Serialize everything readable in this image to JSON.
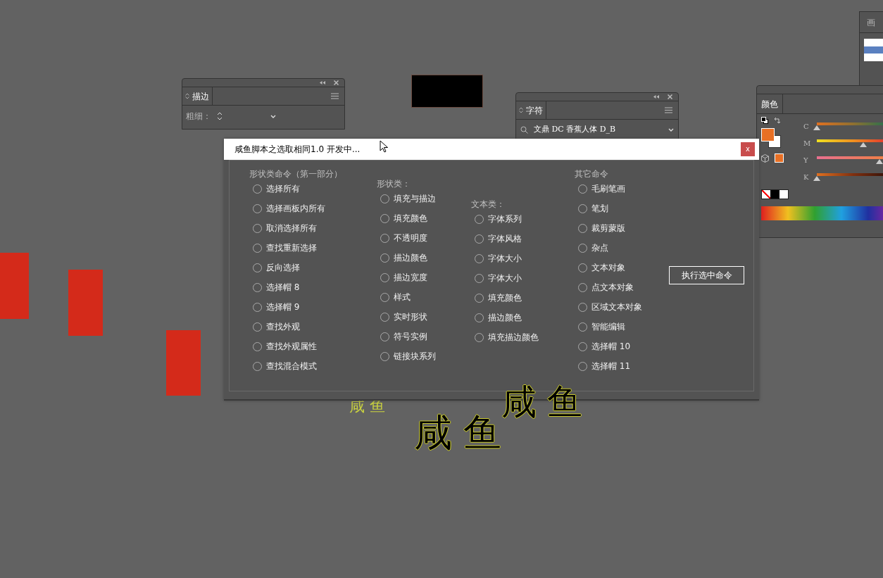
{
  "brush_panel": {
    "tab": "画"
  },
  "stroke_panel": {
    "tab": "描边",
    "weight_label": "粗细："
  },
  "character_panel": {
    "tab": "字符",
    "font": "文鼎 DC 香蕉人体 D_B"
  },
  "color_panel": {
    "tab": "颜色",
    "sliders": [
      {
        "label": "C",
        "level": 0
      },
      {
        "label": "M",
        "level": 0.64
      },
      {
        "label": "Y",
        "level": 0.86
      },
      {
        "label": "K",
        "level": 0
      }
    ]
  },
  "canvas_texts": [
    {
      "text": "咸鱼",
      "kind": "fill"
    },
    {
      "text": "咸鱼",
      "kind": "outline"
    },
    {
      "text": "咸鱼",
      "kind": "outline"
    }
  ],
  "dialog": {
    "title": "咸鱼脚本之选取相同1.0 开发中...",
    "close": "x",
    "sections": [
      {
        "heading": "形状类命令（第一部分）",
        "options": [
          {
            "label": "选择所有",
            "selected": false
          },
          {
            "label": "选择画板内所有",
            "selected": false
          },
          {
            "label": "取消选择所有",
            "selected": false
          },
          {
            "label": "查找重新选择",
            "selected": false
          },
          {
            "label": "反向选择",
            "selected": false
          },
          {
            "label": "选择帽 8",
            "selected": false
          },
          {
            "label": "选择帽 9",
            "selected": false
          },
          {
            "label": "查找外观",
            "selected": false
          },
          {
            "label": "查找外观属性",
            "selected": false
          },
          {
            "label": "查找混合模式",
            "selected": false
          }
        ]
      },
      {
        "heading": "形状类：",
        "options": [
          {
            "label": "填充与描边",
            "selected": false
          },
          {
            "label": "填充颜色",
            "selected": false
          },
          {
            "label": "不透明度",
            "selected": false
          },
          {
            "label": "描边颜色",
            "selected": false
          },
          {
            "label": "描边宽度",
            "selected": false
          },
          {
            "label": "样式",
            "selected": false
          },
          {
            "label": "实时形状",
            "selected": false
          },
          {
            "label": "符号实例",
            "selected": false
          },
          {
            "label": "链接块系列",
            "selected": false
          }
        ]
      },
      {
        "heading": "文本类：",
        "options": [
          {
            "label": "字体系列",
            "selected": false
          },
          {
            "label": "字体风格",
            "selected": false
          },
          {
            "label": "字体大小",
            "selected": false
          },
          {
            "label": "字体大小",
            "selected": false
          },
          {
            "label": "填充颜色",
            "selected": false
          },
          {
            "label": "描边颜色",
            "selected": false
          },
          {
            "label": "填充描边颜色",
            "selected": false
          }
        ]
      },
      {
        "heading": "其它命令",
        "options": [
          {
            "label": "毛刷笔画",
            "selected": false
          },
          {
            "label": "笔划",
            "selected": false
          },
          {
            "label": "裁剪蒙版",
            "selected": false
          },
          {
            "label": "杂点",
            "selected": false
          },
          {
            "label": "文本对象",
            "selected": false
          },
          {
            "label": "点文本对象",
            "selected": false
          },
          {
            "label": "区域文本对象",
            "selected": false
          },
          {
            "label": "智能编辑",
            "selected": false
          },
          {
            "label": "选择帽 10",
            "selected": false
          },
          {
            "label": "选择帽 11",
            "selected": false
          }
        ]
      }
    ],
    "execute_button": "执行选中命令"
  }
}
